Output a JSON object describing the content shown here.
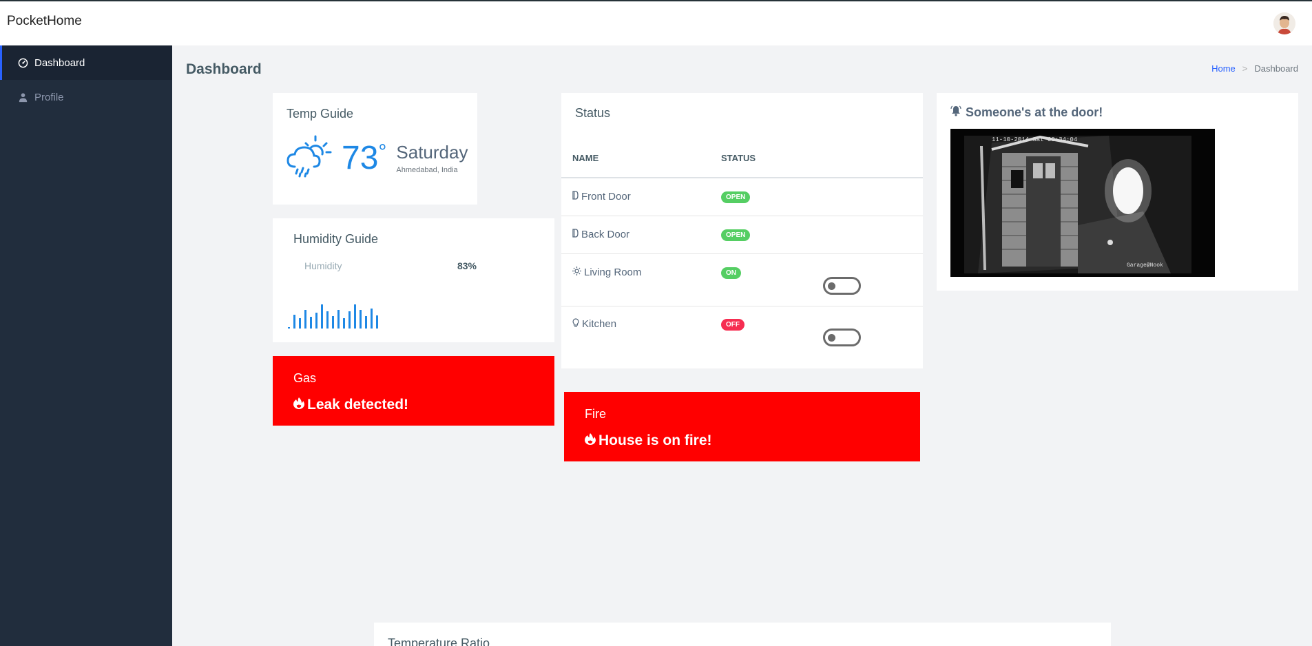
{
  "app": {
    "brand": "PocketHome"
  },
  "sidebar": {
    "items": [
      {
        "label": "Dashboard",
        "icon": "gauge-icon",
        "active": true
      },
      {
        "label": "Profile",
        "icon": "user-icon",
        "active": false
      }
    ]
  },
  "header": {
    "title": "Dashboard",
    "breadcrumb": {
      "home": "Home",
      "current": "Dashboard"
    }
  },
  "temp_guide": {
    "title": "Temp Guide",
    "icon": "cloud-sun-rain-icon",
    "temperature": "73",
    "degree_symbol": "°",
    "day": "Saturday",
    "location": "Ahmedabad, India"
  },
  "humidity_guide": {
    "title": "Humidity Guide",
    "label": "Humidity",
    "value": "83%"
  },
  "status": {
    "title": "Status",
    "columns": [
      "NAME",
      "STATUS"
    ],
    "rows": [
      {
        "name": "Front Door",
        "icon": "door-icon",
        "status": "OPEN",
        "color": "#55ce63",
        "has_toggle": false
      },
      {
        "name": "Back Door",
        "icon": "door-icon",
        "status": "OPEN",
        "color": "#55ce63",
        "has_toggle": false
      },
      {
        "name": "Living Room",
        "icon": "sun-bulb-icon",
        "status": "ON",
        "color": "#55ce63",
        "has_toggle": true
      },
      {
        "name": "Kitchen",
        "icon": "bulb-icon",
        "status": "OFF",
        "color": "#f62d51",
        "has_toggle": true
      }
    ]
  },
  "door": {
    "title": "Someone's at the door!",
    "icon": "bell-icon",
    "camera_timestamp": "11-10-2014 Sat 00:34:04",
    "camera_label": "Garage@Nook"
  },
  "alerts": {
    "gas": {
      "title": "Gas",
      "message": "Leak detected!",
      "icon": "fire-icon",
      "color": "#ff0000"
    },
    "fire": {
      "title": "Fire",
      "message": "House is on fire!",
      "icon": "fire-icon",
      "color": "#ff0000"
    }
  },
  "temperature_ratio": {
    "title": "Temperature Ratio"
  },
  "colors": {
    "accent": "#1e88e5",
    "sidebar_bg": "#212d3d",
    "success": "#55ce63",
    "danger": "#f62d51"
  }
}
